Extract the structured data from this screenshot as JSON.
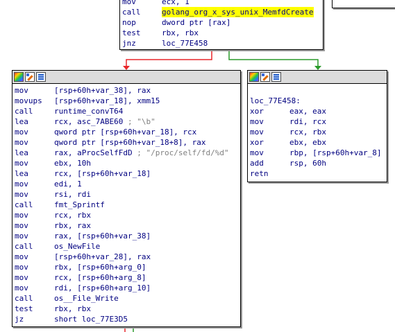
{
  "top_block": {
    "lines": [
      {
        "mn": "mov",
        "op": "ecx, 1"
      },
      {
        "mn": "call",
        "op": "golang_org_x_sys_unix_MemfdCreate",
        "highlight": true
      },
      {
        "mn": "nop",
        "op": "dword ptr [rax]"
      },
      {
        "mn": "test",
        "op": "rbx, rbx"
      },
      {
        "mn": "jnz",
        "op": "loc_77E458"
      }
    ]
  },
  "left_block": {
    "lines": [
      {
        "mn": "mov",
        "op": "[rsp+60h+var_38], rax"
      },
      {
        "mn": "movups",
        "op": "[rsp+60h+var_18], xmm15"
      },
      {
        "mn": "call",
        "op": "runtime_convT64"
      },
      {
        "mn": "lea",
        "op": "rcx, asc_7ABE60",
        "comment": "; \"\\b\""
      },
      {
        "mn": "mov",
        "op": "qword ptr [rsp+60h+var_18], rcx"
      },
      {
        "mn": "mov",
        "op": "qword ptr [rsp+60h+var_18+8], rax"
      },
      {
        "mn": "lea",
        "op": "rax, aProcSelfFdD",
        "comment": "; \"/proc/self/fd/%d\""
      },
      {
        "mn": "mov",
        "op": "ebx, 10h"
      },
      {
        "mn": "lea",
        "op": "rcx, [rsp+60h+var_18]"
      },
      {
        "mn": "mov",
        "op": "edi, 1"
      },
      {
        "mn": "mov",
        "op": "rsi, rdi"
      },
      {
        "mn": "call",
        "op": "fmt_Sprintf"
      },
      {
        "mn": "mov",
        "op": "rcx, rbx"
      },
      {
        "mn": "mov",
        "op": "rbx, rax"
      },
      {
        "mn": "mov",
        "op": "rax, [rsp+60h+var_38]"
      },
      {
        "mn": "call",
        "op": "os_NewFile"
      },
      {
        "mn": "mov",
        "op": "[rsp+60h+var_28], rax"
      },
      {
        "mn": "mov",
        "op": "rbx, [rsp+60h+arg_0]"
      },
      {
        "mn": "mov",
        "op": "rcx, [rsp+60h+arg_8]"
      },
      {
        "mn": "mov",
        "op": "rdi, [rsp+60h+arg_10]"
      },
      {
        "mn": "call",
        "op": "os__File_Write"
      },
      {
        "mn": "test",
        "op": "rbx, rbx"
      },
      {
        "mn": "jz",
        "op": "short loc_77E3D5"
      }
    ]
  },
  "right_block": {
    "label": "loc_77E458:",
    "lines": [
      {
        "mn": "xor",
        "op": "eax, eax"
      },
      {
        "mn": "mov",
        "op": "rdi, rcx"
      },
      {
        "mn": "mov",
        "op": "rcx, rbx"
      },
      {
        "mn": "xor",
        "op": "ebx, ebx"
      },
      {
        "mn": "mov",
        "op": "rbp, [rsp+60h+var_8]"
      },
      {
        "mn": "add",
        "op": "rsp, 60h"
      },
      {
        "mn": "retn",
        "op": ""
      }
    ]
  },
  "colors": {
    "false_edge": "#e8262a",
    "true_edge": "#2a9a2a",
    "highlight": "#ffff00",
    "code_text": "#000080",
    "comment_text": "#808080"
  }
}
